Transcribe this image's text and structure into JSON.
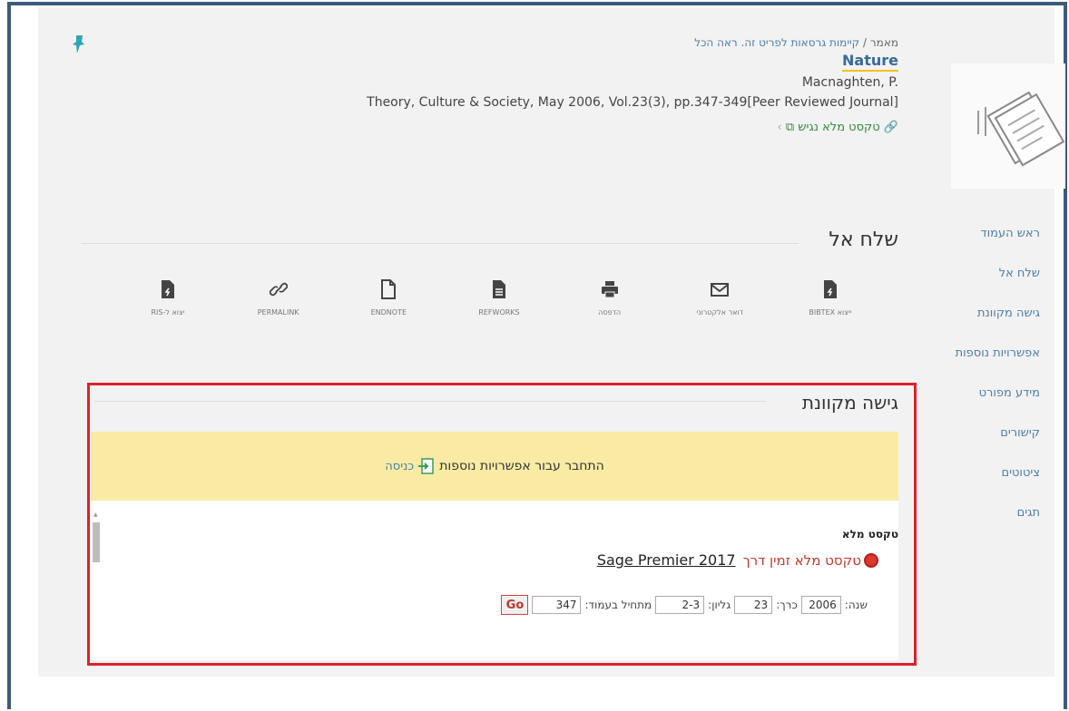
{
  "record": {
    "type_label": "מאמר",
    "versions_link": "קיימות גרסאות לפריט זה. ראה הכל",
    "title": "Nature",
    "author": "Macnaghten, P.",
    "source": "Theory, Culture & Society, May 2006, Vol.23(3), pp.347-349[Peer Reviewed Journal]",
    "availability": "טקסט מלא נגיש"
  },
  "sidenav": {
    "items": [
      "ראש העמוד",
      "שלח אל",
      "גישה מקוונת",
      "אפשרויות נוספות",
      "מידע מפורט",
      "קישורים",
      "ציטוטים",
      "תגים"
    ]
  },
  "send_to": {
    "title": "שלח אל",
    "actions": [
      {
        "label": "ייצוא BIBTEX",
        "icon": "bibtex-file-icon"
      },
      {
        "label": "דואר אלקטרוני",
        "icon": "email-icon"
      },
      {
        "label": "הדפסה",
        "icon": "print-icon"
      },
      {
        "label": "REFWORKS",
        "icon": "refworks-file-icon"
      },
      {
        "label": "ENDNOTE",
        "icon": "endnote-file-icon"
      },
      {
        "label": "PERMALINK",
        "icon": "link-icon"
      },
      {
        "label": "יצוא ל-RIS",
        "icon": "ris-file-icon"
      }
    ]
  },
  "online_access": {
    "title": "גישה מקוונת",
    "login_text": "התחבר עבור אפשרויות נוספות",
    "login_link": "כניסה",
    "fulltext_heading": "טקסט מלא",
    "fulltext_available": "טקסט מלא זמין דרך",
    "provider": "Sage Premier 2017",
    "form": {
      "year_label": "שנה:",
      "year_value": "2006",
      "volume_label": "כרך:",
      "volume_value": "23",
      "issue_label": "גליון:",
      "issue_value": "2-3",
      "start_page_label": "מתחיל בעמוד:",
      "start_page_value": "347",
      "go_label": "Go"
    }
  },
  "colors": {
    "accent_blue": "#4a7fa8",
    "highlight_box": "#e0202a",
    "login_bar": "#f9eba4",
    "available_green": "#2e8b3a"
  }
}
